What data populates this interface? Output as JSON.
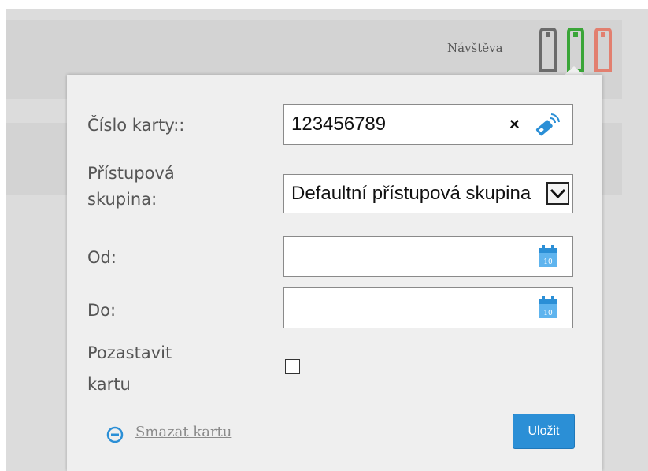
{
  "header": {
    "visit_label": "Návštěva",
    "clips": [
      {
        "name": "gray-clip-icon",
        "color": "#6b6b6b"
      },
      {
        "name": "green-clip-icon",
        "color": "#3aa538"
      },
      {
        "name": "red-clip-icon",
        "color": "#e27f6f"
      }
    ]
  },
  "form": {
    "card_number": {
      "label": "Číslo karty::",
      "value": "123456789",
      "clear_glyph": "×",
      "icon": "nfc-reader-icon"
    },
    "access_group": {
      "label_line1": "Přístupová",
      "label_line2": "skupina:",
      "selected": "Defaultní přístupová skupina"
    },
    "from": {
      "label": "Od:",
      "value": "",
      "icon": "calendar-icon",
      "day": "10"
    },
    "to": {
      "label": "Do:",
      "value": "",
      "icon": "calendar-icon",
      "day": "10"
    },
    "suspend": {
      "label_line1": "Pozastavit",
      "label_line2": "kartu",
      "checked": false
    },
    "delete_link": "Smazat kartu",
    "save_button": "Uložit"
  },
  "colors": {
    "accent": "#2b8fd6",
    "popup_bg": "#efefef"
  }
}
